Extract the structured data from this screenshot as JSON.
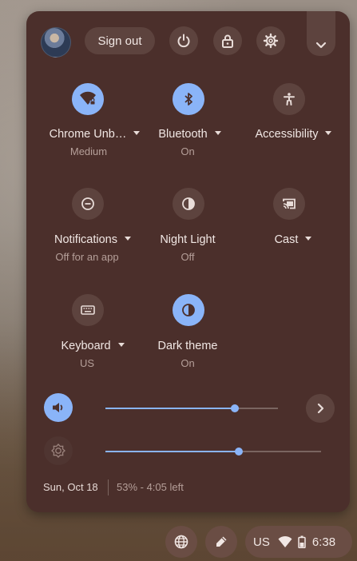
{
  "header": {
    "sign_out_label": "Sign out"
  },
  "tiles": [
    {
      "label": "Chrome Unb…",
      "sub": "Medium",
      "icon": "wifi-icon",
      "state": "on"
    },
    {
      "label": "Bluetooth",
      "sub": "On",
      "icon": "bluetooth-icon",
      "state": "on"
    },
    {
      "label": "Accessibility",
      "sub": "",
      "icon": "accessibility-icon",
      "state": "off"
    },
    {
      "label": "Notifications",
      "sub": "Off for an app",
      "icon": "notifications-icon",
      "state": "off"
    },
    {
      "label": "Night Light",
      "sub": "Off",
      "icon": "night-light-icon",
      "state": "off"
    },
    {
      "label": "Cast",
      "sub": "",
      "icon": "cast-icon",
      "state": "off"
    },
    {
      "label": "Keyboard",
      "sub": "US",
      "icon": "keyboard-icon",
      "state": "off"
    },
    {
      "label": "Dark theme",
      "sub": "On",
      "icon": "dark-theme-icon",
      "state": "on"
    }
  ],
  "sliders": {
    "volume_level": 0.75,
    "brightness_level": 0.62
  },
  "footer": {
    "date": "Sun, Oct 18",
    "battery": "53% - 4:05 left"
  },
  "tray": {
    "ime": "US",
    "time": "6:38"
  },
  "colors": {
    "panel_bg": "#4b2f2b",
    "accent": "#8ab4f8",
    "button_bg": "#5d433e"
  }
}
